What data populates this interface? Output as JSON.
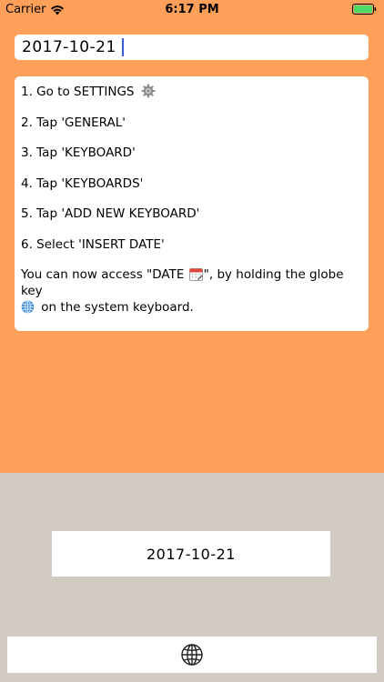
{
  "status_bar": {
    "carrier": "Carrier",
    "time": "6:17 PM",
    "wifi_icon": "wifi-icon",
    "battery_icon": "battery-icon"
  },
  "date_field": {
    "value": "2017-10-21"
  },
  "instructions": {
    "steps": [
      "1. Go to SETTINGS",
      "2. Tap 'GENERAL'",
      "3. Tap 'KEYBOARD'",
      "4. Tap 'KEYBOARDS'",
      "5. Tap 'ADD NEW KEYBOARD'",
      "6. Select 'INSERT DATE'"
    ],
    "note_before_icon": "You can now access \"DATE ",
    "note_middle": "\", by holding the globe key",
    "note_after_icon": " on the system keyboard.",
    "step1_icon": "gear-icon",
    "note_icon_1": "calendar-icon",
    "note_icon_2": "globe-icon"
  },
  "keyboard": {
    "date_key_label": "2017-10-21",
    "bottom_icon": "globe-icon"
  },
  "colors": {
    "background": "#ffa05a",
    "keyboard_background": "#d2cbc2",
    "caret": "#3a5bd9"
  }
}
